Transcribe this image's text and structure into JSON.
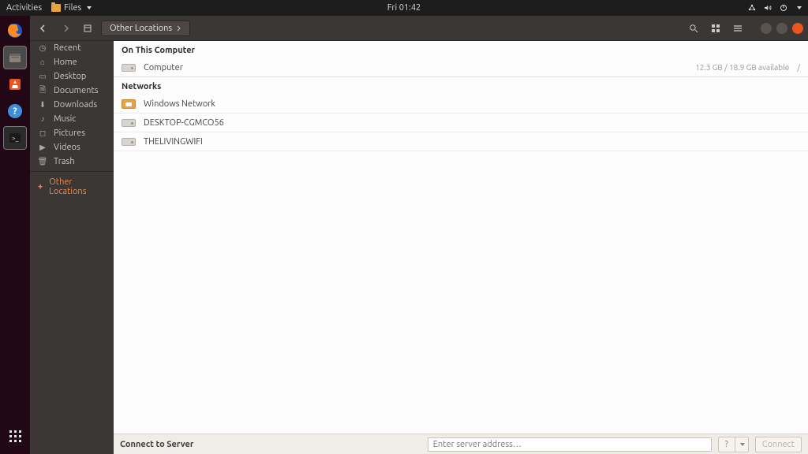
{
  "topbar": {
    "activities": "Activities",
    "app_name": "Files",
    "clock": "Fri 01:42"
  },
  "headerbar": {
    "location": "Other Locations"
  },
  "sidebar": {
    "items": [
      {
        "label": "Recent"
      },
      {
        "label": "Home"
      },
      {
        "label": "Desktop"
      },
      {
        "label": "Documents"
      },
      {
        "label": "Downloads"
      },
      {
        "label": "Music"
      },
      {
        "label": "Pictures"
      },
      {
        "label": "Videos"
      },
      {
        "label": "Trash"
      }
    ],
    "other_label": "Other Locations"
  },
  "main": {
    "section_computer": "On This Computer",
    "computer": {
      "label": "Computer",
      "usage": "12.3 GB / 18.9 GB available",
      "fs": "/"
    },
    "section_networks": "Networks",
    "networks": [
      {
        "label": "Windows Network"
      },
      {
        "label": "DESKTOP-CGMCO56"
      },
      {
        "label": "THELIVINGWIFI"
      }
    ]
  },
  "footer": {
    "label": "Connect to Server",
    "placeholder": "Enter server address…",
    "help": "?",
    "connect": "Connect"
  }
}
